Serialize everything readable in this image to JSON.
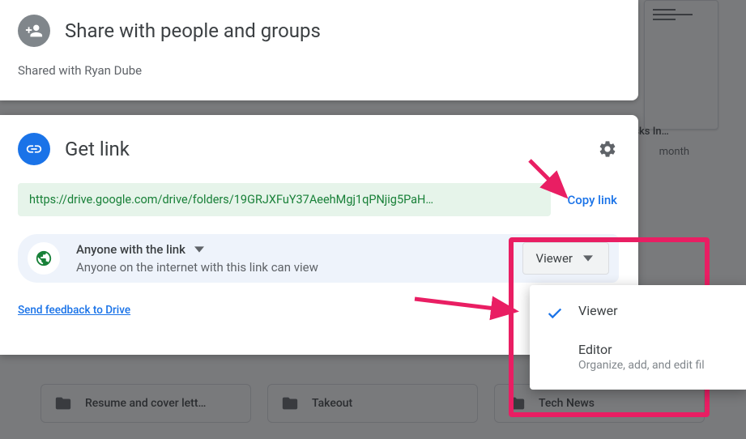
{
  "share": {
    "title": "Share with people and groups",
    "shared_with": "Shared with Ryan Dube"
  },
  "getlink": {
    "title": "Get link",
    "url": "https://drive.google.com/drive/folders/19GRJXFuY37AeehMgj1qPNjig5PaH…",
    "copy_label": "Copy link",
    "access_title": "Anyone with the link",
    "access_sub": "Anyone on the internet with this link can view",
    "role_selected": "Viewer",
    "feedback": "Send feedback to Drive"
  },
  "role_menu": {
    "options": [
      {
        "name": "Viewer",
        "desc": "",
        "selected": true
      },
      {
        "name": "Editor",
        "desc": "Organize, add, and edit fil",
        "selected": false
      }
    ]
  },
  "background": {
    "thumb_title": "tasks In…",
    "thumb_sub": "month",
    "folders": [
      "Resume and cover lett…",
      "Takeout",
      "Tech News"
    ]
  },
  "annotation": {
    "color": "#e91e63"
  }
}
